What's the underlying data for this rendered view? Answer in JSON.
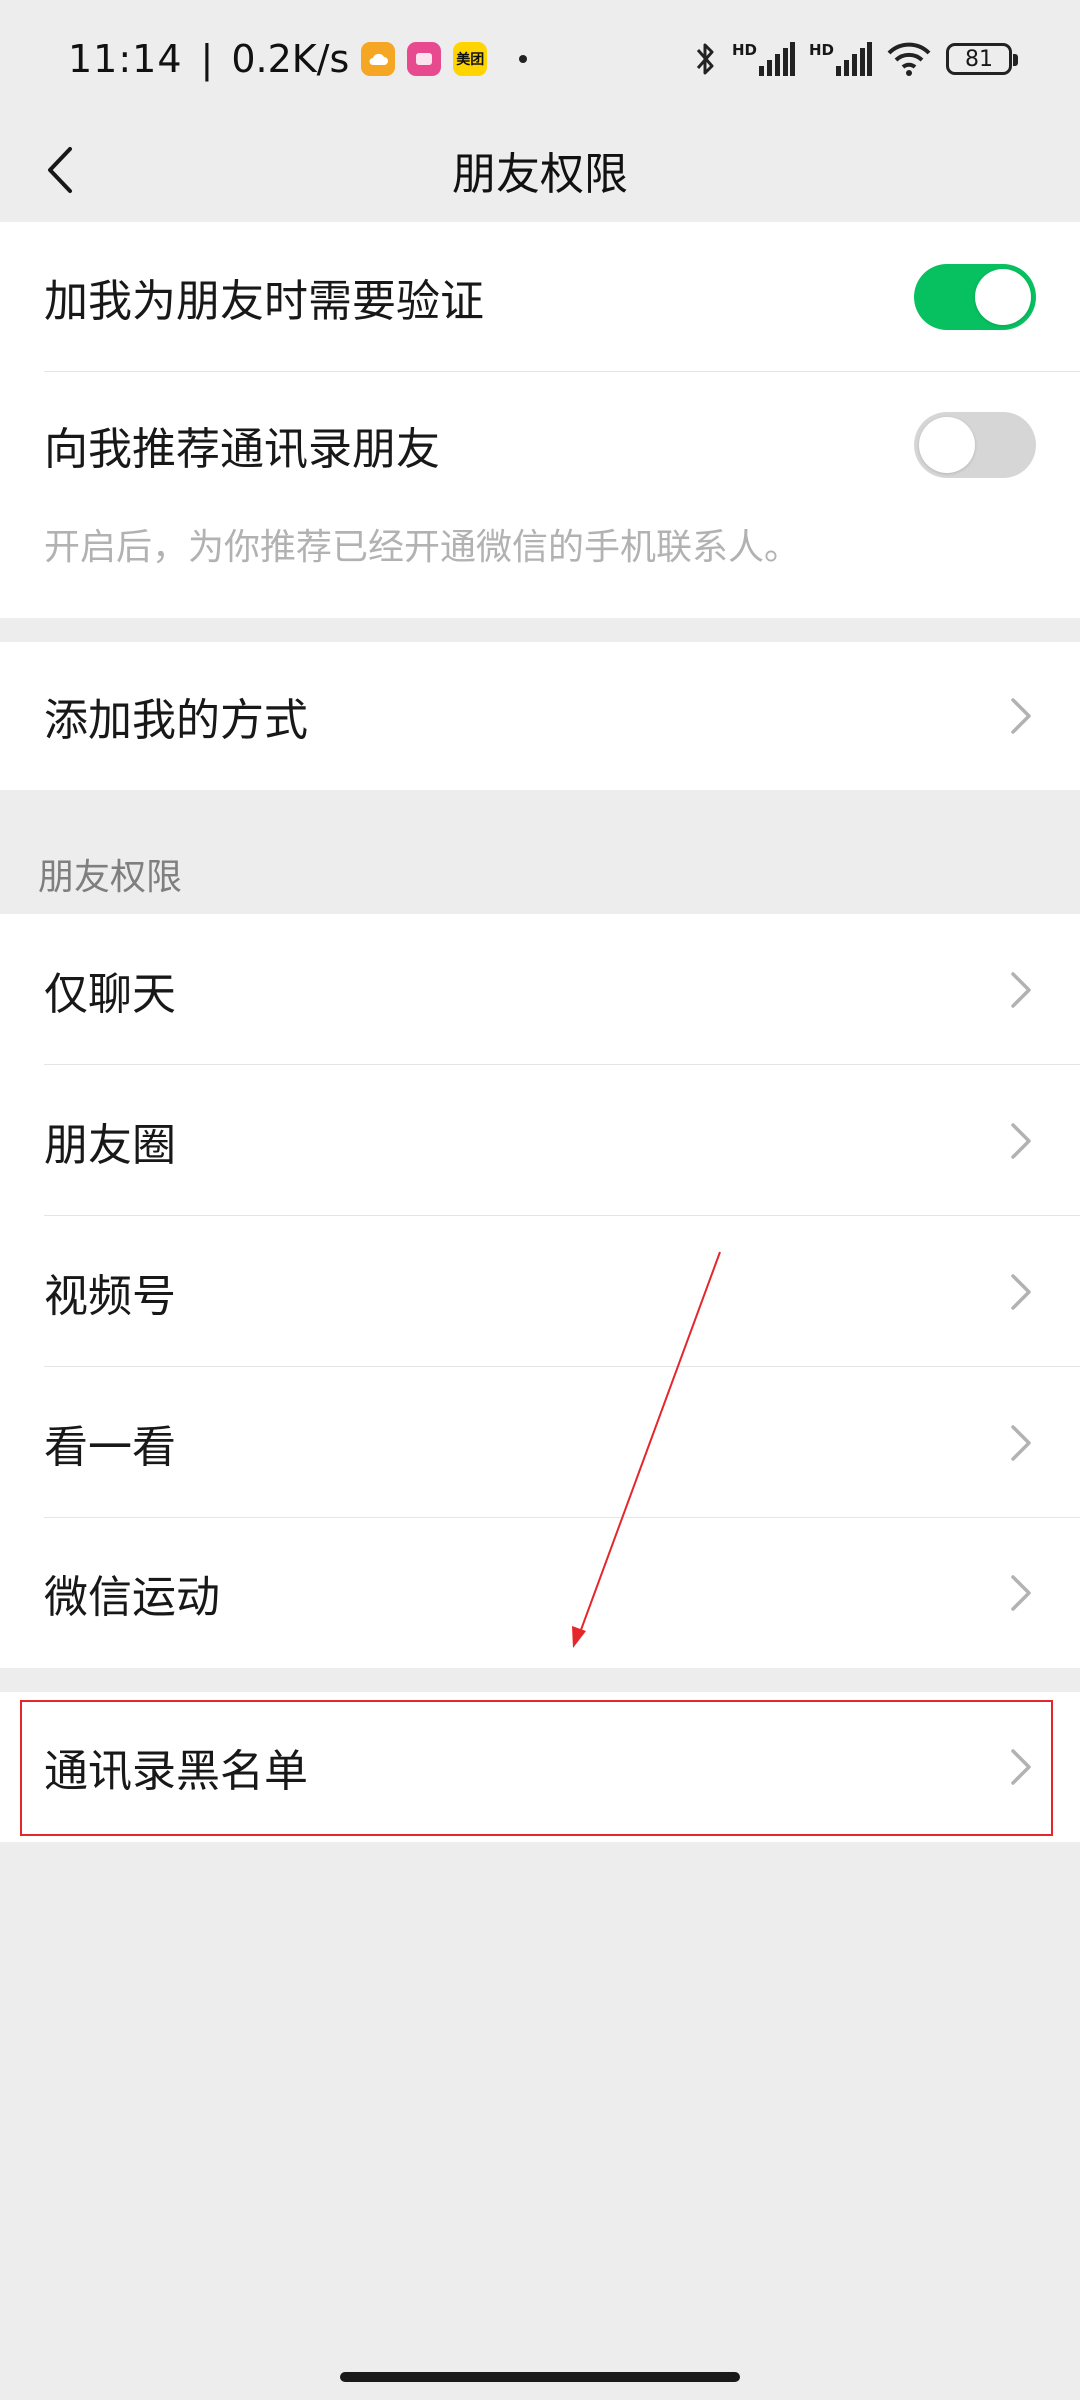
{
  "status_bar": {
    "time": "11:14",
    "separator": "|",
    "speed": "0.2K/s",
    "hd1": "HD",
    "hd2": "HD",
    "battery": "81",
    "badges": {
      "orange": {
        "icon": "weather-cloud-icon",
        "color": "#f5a623"
      },
      "pink": {
        "icon": "shopping-app-icon",
        "color": "#e84a8f"
      },
      "yellow": {
        "label": "美团",
        "color": "#ffd400"
      }
    }
  },
  "nav": {
    "title": "朋友权限",
    "back_icon": "chevron-left-icon"
  },
  "verification": {
    "add_friend_verify_label": "加我为朋友时需要验证",
    "add_friend_verify_on": true,
    "recommend_contacts_label": "向我推荐通讯录朋友",
    "recommend_contacts_on": false,
    "recommend_contacts_desc": "开启后，为你推荐已经开通微信的手机联系人。"
  },
  "add_methods": {
    "label": "添加我的方式"
  },
  "friend_permissions": {
    "header": "朋友权限",
    "items": [
      {
        "label": "仅聊天"
      },
      {
        "label": "朋友圈"
      },
      {
        "label": "视频号"
      },
      {
        "label": "看一看"
      },
      {
        "label": "微信运动"
      }
    ]
  },
  "blacklist": {
    "label": "通讯录黑名单"
  },
  "colors": {
    "accent_green": "#07c160",
    "toggle_off": "#d6d6d6",
    "background": "#ededed",
    "annotation_red": "#e5262a"
  }
}
